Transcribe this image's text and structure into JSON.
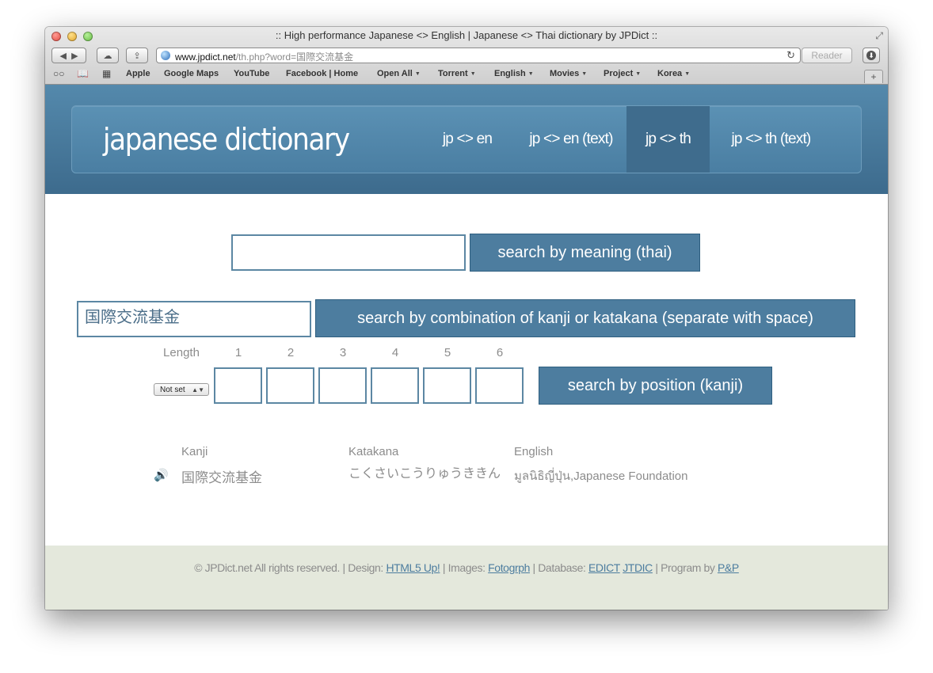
{
  "browser": {
    "title": ":: High performance Japanese <> English | Japanese <> Thai dictionary by JPDict ::",
    "url_host": "www.jpdict.net",
    "url_rest": "/th.php?word=国際交流基金",
    "reader_label": "Reader",
    "bookmarks": [
      "Apple",
      "Google Maps",
      "YouTube",
      "Facebook | Home",
      "Open All",
      "Torrent",
      "English",
      "Movies",
      "Project",
      "Korea"
    ]
  },
  "site": {
    "logo": "japanese dictionary",
    "nav": [
      "jp <> en",
      "jp <> en (text)",
      "jp <> th",
      "jp <> th (text)"
    ],
    "active_nav": "jp <> th"
  },
  "search": {
    "meaning_value": "",
    "meaning_button": "search by meaning (thai)",
    "combo_value": "国際交流基金",
    "combo_button": "search by combination of kanji or katakana (separate with space)",
    "length_label": "Length",
    "positions": [
      "1",
      "2",
      "3",
      "4",
      "5",
      "6"
    ],
    "length_select": "Not set",
    "position_button": "search by position (kanji)"
  },
  "results": {
    "headers": [
      "Kanji",
      "Katakana",
      "English"
    ],
    "rows": [
      {
        "kanji": "国際交流基金",
        "katakana": "こくさいこうりゅうききん",
        "english": "มูลนิธิญี่ปุ่น,Japanese Foundation"
      }
    ]
  },
  "footer": {
    "prefix": "© JPDict.net All rights reserved. | Design:",
    "design_link": "HTML5 Up!",
    "images_label": "| Images:",
    "images_link": "Fotogrph",
    "database_label": "| Database:",
    "edict_link": "EDICT",
    "jtdic_link": "JTDIC",
    "program_label": "| Program by",
    "program_link": "P&P"
  }
}
